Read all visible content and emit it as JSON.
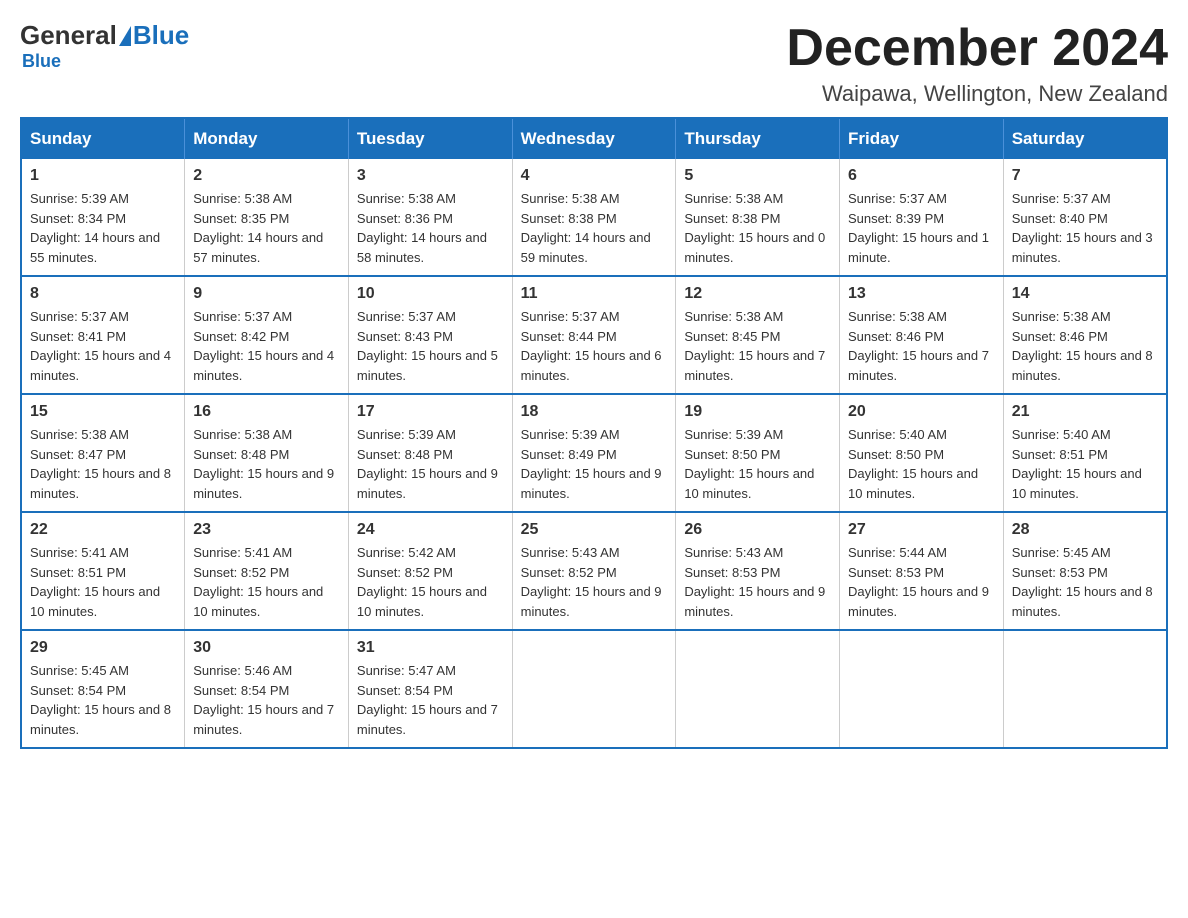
{
  "logo": {
    "general": "General",
    "blue": "Blue",
    "subtitle": "Blue"
  },
  "header": {
    "title": "December 2024",
    "location": "Waipawa, Wellington, New Zealand"
  },
  "days_of_week": [
    "Sunday",
    "Monday",
    "Tuesday",
    "Wednesday",
    "Thursday",
    "Friday",
    "Saturday"
  ],
  "weeks": [
    [
      {
        "day": "1",
        "sunrise": "5:39 AM",
        "sunset": "8:34 PM",
        "daylight": "14 hours and 55 minutes."
      },
      {
        "day": "2",
        "sunrise": "5:38 AM",
        "sunset": "8:35 PM",
        "daylight": "14 hours and 57 minutes."
      },
      {
        "day": "3",
        "sunrise": "5:38 AM",
        "sunset": "8:36 PM",
        "daylight": "14 hours and 58 minutes."
      },
      {
        "day": "4",
        "sunrise": "5:38 AM",
        "sunset": "8:38 PM",
        "daylight": "14 hours and 59 minutes."
      },
      {
        "day": "5",
        "sunrise": "5:38 AM",
        "sunset": "8:38 PM",
        "daylight": "15 hours and 0 minutes."
      },
      {
        "day": "6",
        "sunrise": "5:37 AM",
        "sunset": "8:39 PM",
        "daylight": "15 hours and 1 minute."
      },
      {
        "day": "7",
        "sunrise": "5:37 AM",
        "sunset": "8:40 PM",
        "daylight": "15 hours and 3 minutes."
      }
    ],
    [
      {
        "day": "8",
        "sunrise": "5:37 AM",
        "sunset": "8:41 PM",
        "daylight": "15 hours and 4 minutes."
      },
      {
        "day": "9",
        "sunrise": "5:37 AM",
        "sunset": "8:42 PM",
        "daylight": "15 hours and 4 minutes."
      },
      {
        "day": "10",
        "sunrise": "5:37 AM",
        "sunset": "8:43 PM",
        "daylight": "15 hours and 5 minutes."
      },
      {
        "day": "11",
        "sunrise": "5:37 AM",
        "sunset": "8:44 PM",
        "daylight": "15 hours and 6 minutes."
      },
      {
        "day": "12",
        "sunrise": "5:38 AM",
        "sunset": "8:45 PM",
        "daylight": "15 hours and 7 minutes."
      },
      {
        "day": "13",
        "sunrise": "5:38 AM",
        "sunset": "8:46 PM",
        "daylight": "15 hours and 7 minutes."
      },
      {
        "day": "14",
        "sunrise": "5:38 AM",
        "sunset": "8:46 PM",
        "daylight": "15 hours and 8 minutes."
      }
    ],
    [
      {
        "day": "15",
        "sunrise": "5:38 AM",
        "sunset": "8:47 PM",
        "daylight": "15 hours and 8 minutes."
      },
      {
        "day": "16",
        "sunrise": "5:38 AM",
        "sunset": "8:48 PM",
        "daylight": "15 hours and 9 minutes."
      },
      {
        "day": "17",
        "sunrise": "5:39 AM",
        "sunset": "8:48 PM",
        "daylight": "15 hours and 9 minutes."
      },
      {
        "day": "18",
        "sunrise": "5:39 AM",
        "sunset": "8:49 PM",
        "daylight": "15 hours and 9 minutes."
      },
      {
        "day": "19",
        "sunrise": "5:39 AM",
        "sunset": "8:50 PM",
        "daylight": "15 hours and 10 minutes."
      },
      {
        "day": "20",
        "sunrise": "5:40 AM",
        "sunset": "8:50 PM",
        "daylight": "15 hours and 10 minutes."
      },
      {
        "day": "21",
        "sunrise": "5:40 AM",
        "sunset": "8:51 PM",
        "daylight": "15 hours and 10 minutes."
      }
    ],
    [
      {
        "day": "22",
        "sunrise": "5:41 AM",
        "sunset": "8:51 PM",
        "daylight": "15 hours and 10 minutes."
      },
      {
        "day": "23",
        "sunrise": "5:41 AM",
        "sunset": "8:52 PM",
        "daylight": "15 hours and 10 minutes."
      },
      {
        "day": "24",
        "sunrise": "5:42 AM",
        "sunset": "8:52 PM",
        "daylight": "15 hours and 10 minutes."
      },
      {
        "day": "25",
        "sunrise": "5:43 AM",
        "sunset": "8:52 PM",
        "daylight": "15 hours and 9 minutes."
      },
      {
        "day": "26",
        "sunrise": "5:43 AM",
        "sunset": "8:53 PM",
        "daylight": "15 hours and 9 minutes."
      },
      {
        "day": "27",
        "sunrise": "5:44 AM",
        "sunset": "8:53 PM",
        "daylight": "15 hours and 9 minutes."
      },
      {
        "day": "28",
        "sunrise": "5:45 AM",
        "sunset": "8:53 PM",
        "daylight": "15 hours and 8 minutes."
      }
    ],
    [
      {
        "day": "29",
        "sunrise": "5:45 AM",
        "sunset": "8:54 PM",
        "daylight": "15 hours and 8 minutes."
      },
      {
        "day": "30",
        "sunrise": "5:46 AM",
        "sunset": "8:54 PM",
        "daylight": "15 hours and 7 minutes."
      },
      {
        "day": "31",
        "sunrise": "5:47 AM",
        "sunset": "8:54 PM",
        "daylight": "15 hours and 7 minutes."
      },
      null,
      null,
      null,
      null
    ]
  ],
  "labels": {
    "sunrise": "Sunrise:",
    "sunset": "Sunset:",
    "daylight": "Daylight:"
  }
}
